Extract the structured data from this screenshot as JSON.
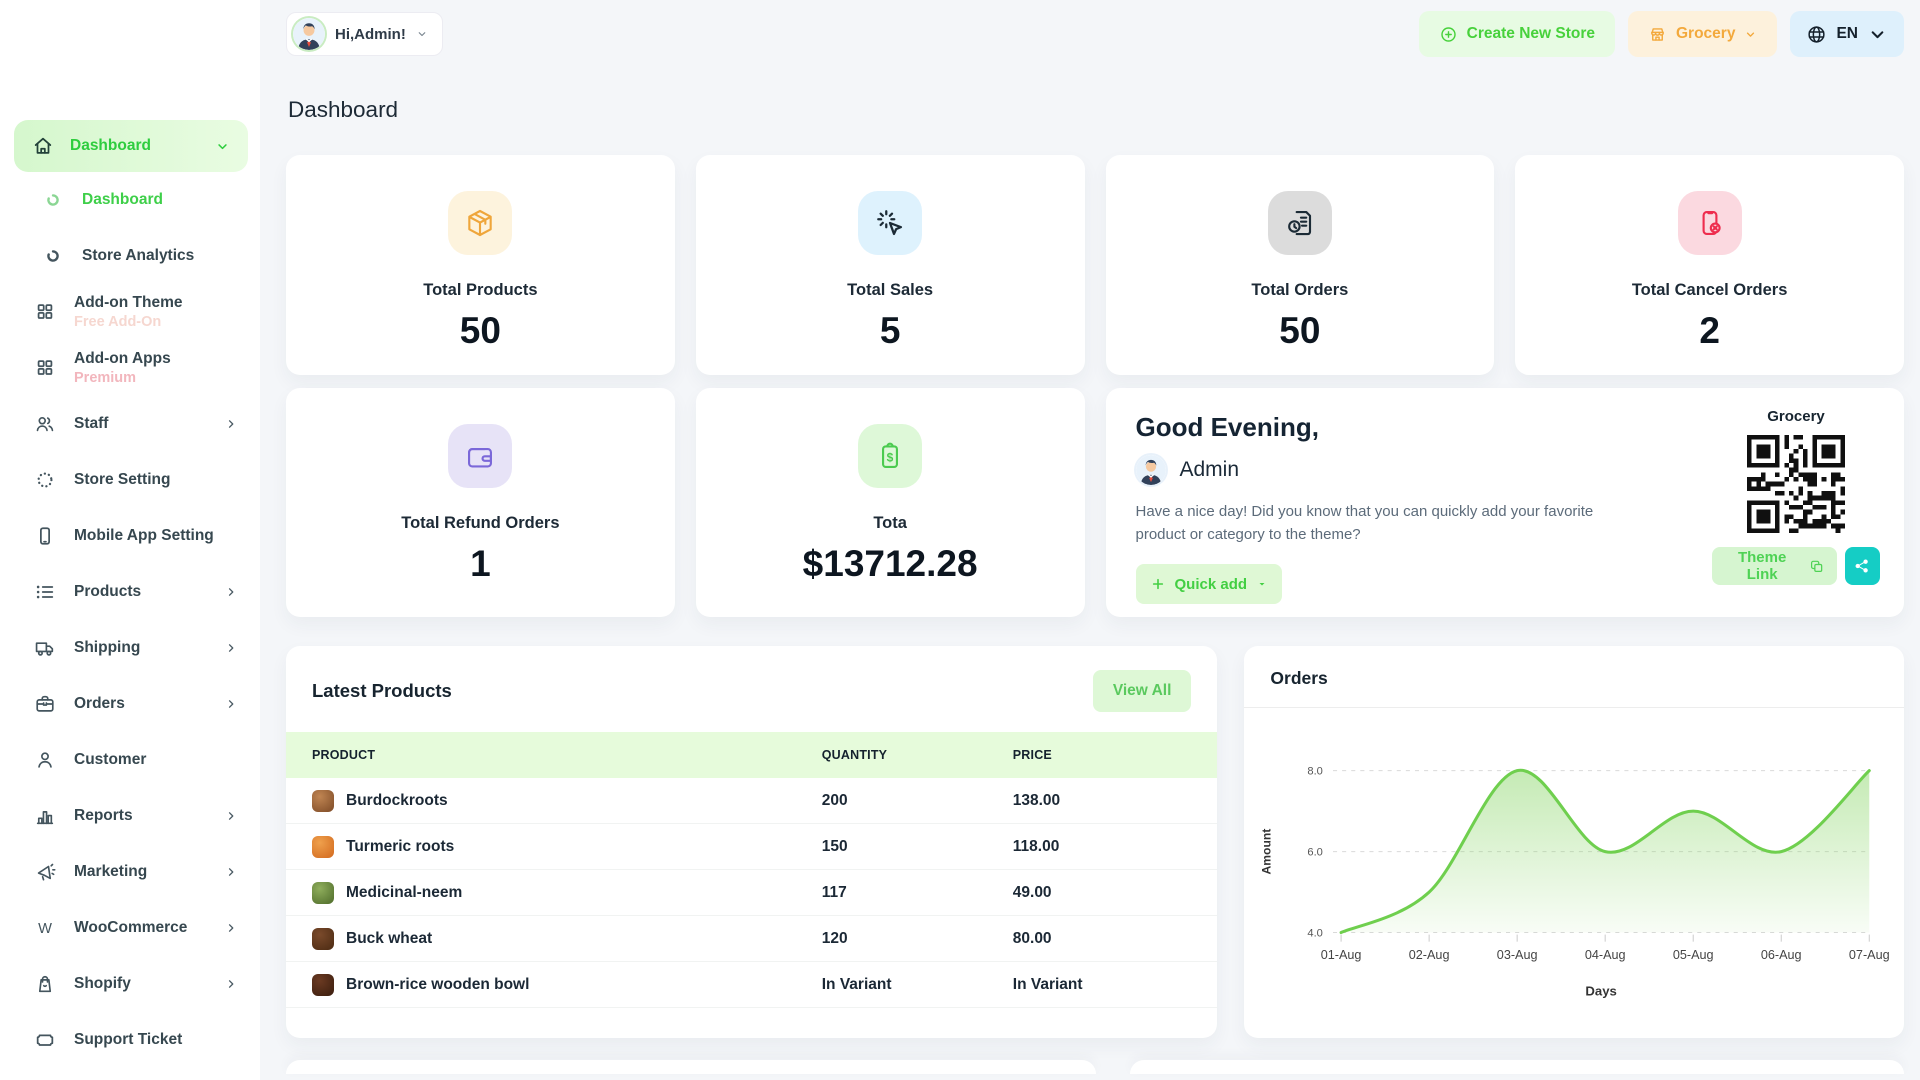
{
  "topbar": {
    "greeting_chip": "Hi,Admin!",
    "create_store": "Create New Store",
    "store_name": "Grocery",
    "language": "EN"
  },
  "page_title": "Dashboard",
  "sidebar": {
    "active_label": "Dashboard",
    "items": [
      {
        "label": "Dashboard",
        "icon": "circle-arc-icon",
        "active": true,
        "indent": true
      },
      {
        "label": "Store Analytics",
        "icon": "circle-arc-icon",
        "indent": true
      },
      {
        "label": "Add-on Theme",
        "icon": "grid-icon",
        "sub": "Free Add-On",
        "sub_color": "#f6d7d0"
      },
      {
        "label": "Add-on Apps",
        "icon": "grid-icon",
        "sub": "Premium",
        "sub_color": "#f2b6bd"
      },
      {
        "label": "Staff",
        "icon": "users-icon",
        "chevron": true
      },
      {
        "label": "Store Setting",
        "icon": "dots-circle-icon"
      },
      {
        "label": "Mobile App Setting",
        "icon": "mobile-icon"
      },
      {
        "label": "Products",
        "icon": "list-icon",
        "chevron": true
      },
      {
        "label": "Shipping",
        "icon": "truck-icon",
        "chevron": true
      },
      {
        "label": "Orders",
        "icon": "briefcase-icon",
        "chevron": true
      },
      {
        "label": "Customer",
        "icon": "user-icon"
      },
      {
        "label": "Reports",
        "icon": "bar-chart-icon",
        "chevron": true
      },
      {
        "label": "Marketing",
        "icon": "megaphone-icon",
        "chevron": true
      },
      {
        "label": "WooCommerce",
        "icon": "woocommerce-icon",
        "chevron": true
      },
      {
        "label": "Shopify",
        "icon": "shopify-bag-icon",
        "chevron": true
      },
      {
        "label": "Support Ticket",
        "icon": "ticket-icon"
      }
    ]
  },
  "stats": [
    {
      "label": "Total Products",
      "value": "50",
      "icon": "package-box-icon",
      "icon_color": "#efa63b",
      "icon_bg": "#fdf3dd"
    },
    {
      "label": "Total Sales",
      "value": "5",
      "icon": "cursor-click-icon",
      "icon_color": "#1c2b36",
      "icon_bg": "#def2fd"
    },
    {
      "label": "Total Orders",
      "value": "50",
      "icon": "order-document-icon",
      "icon_color": "#1c2b36",
      "icon_bg": "#dcdcdc"
    },
    {
      "label": "Total Cancel Orders",
      "value": "2",
      "icon": "phone-cancel-icon",
      "icon_color": "#ee2d4e",
      "icon_bg": "#fbd9e0"
    },
    {
      "label": "Total Refund Orders",
      "value": "1",
      "icon": "wallet-icon",
      "icon_color": "#7b68d9",
      "icon_bg": "#e7e3f7"
    },
    {
      "label": "Tota",
      "value": "$13712.28",
      "icon": "clipboard-dollar-icon",
      "icon_color": "#4bcb4f",
      "icon_bg": "#def8d8"
    }
  ],
  "greeting": {
    "title": "Good Evening,",
    "user": "Admin",
    "message": "Have a nice day! Did you know that you can quickly add your favorite product or category to the theme?",
    "quick_add": "Quick add",
    "store_label": "Grocery",
    "theme_link": "Theme Link"
  },
  "latest_products": {
    "title": "Latest Products",
    "view_all": "View All",
    "columns": [
      "PRODUCT",
      "QUANTITY",
      "PRICE"
    ],
    "rows": [
      {
        "name": "Burdockroots",
        "quantity": "200",
        "price": "138.00",
        "thumb_colors": [
          "#c08552",
          "#7d4a26"
        ]
      },
      {
        "name": "Turmeric roots",
        "quantity": "150",
        "price": "118.00",
        "thumb_colors": [
          "#efa04c",
          "#d2691e"
        ]
      },
      {
        "name": "Medicinal-neem",
        "quantity": "117",
        "price": "49.00",
        "thumb_colors": [
          "#8fae5c",
          "#4e6b2a"
        ]
      },
      {
        "name": "Buck wheat",
        "quantity": "120",
        "price": "80.00",
        "thumb_colors": [
          "#7a4a2b",
          "#4b2a12"
        ]
      },
      {
        "name": "Brown-rice wooden bowl",
        "quantity": "In Variant",
        "price": "In Variant",
        "thumb_colors": [
          "#6b3a22",
          "#3a1d0e"
        ]
      }
    ]
  },
  "orders_card": {
    "title": "Orders"
  },
  "chart_data": {
    "type": "area",
    "title": "Orders",
    "x": [
      "01-Aug",
      "02-Aug",
      "03-Aug",
      "04-Aug",
      "05-Aug",
      "06-Aug",
      "07-Aug"
    ],
    "values": [
      4,
      5,
      8,
      6,
      7,
      6,
      8
    ],
    "xlabel": "Days",
    "ylabel": "Amount",
    "ylim": [
      4,
      8
    ],
    "y_ticks": [
      4.0,
      6.0,
      8.0
    ],
    "grid": "dashed-horizontal",
    "legend": "none",
    "line_color": "#6fcf4e",
    "fill_color": "#8bd66a"
  },
  "colors": {
    "accent_green": "#46d153",
    "accent_orange": "#f3a93c",
    "accent_teal": "#15cdc5",
    "active_pill_bg": "#d9f8d2"
  }
}
